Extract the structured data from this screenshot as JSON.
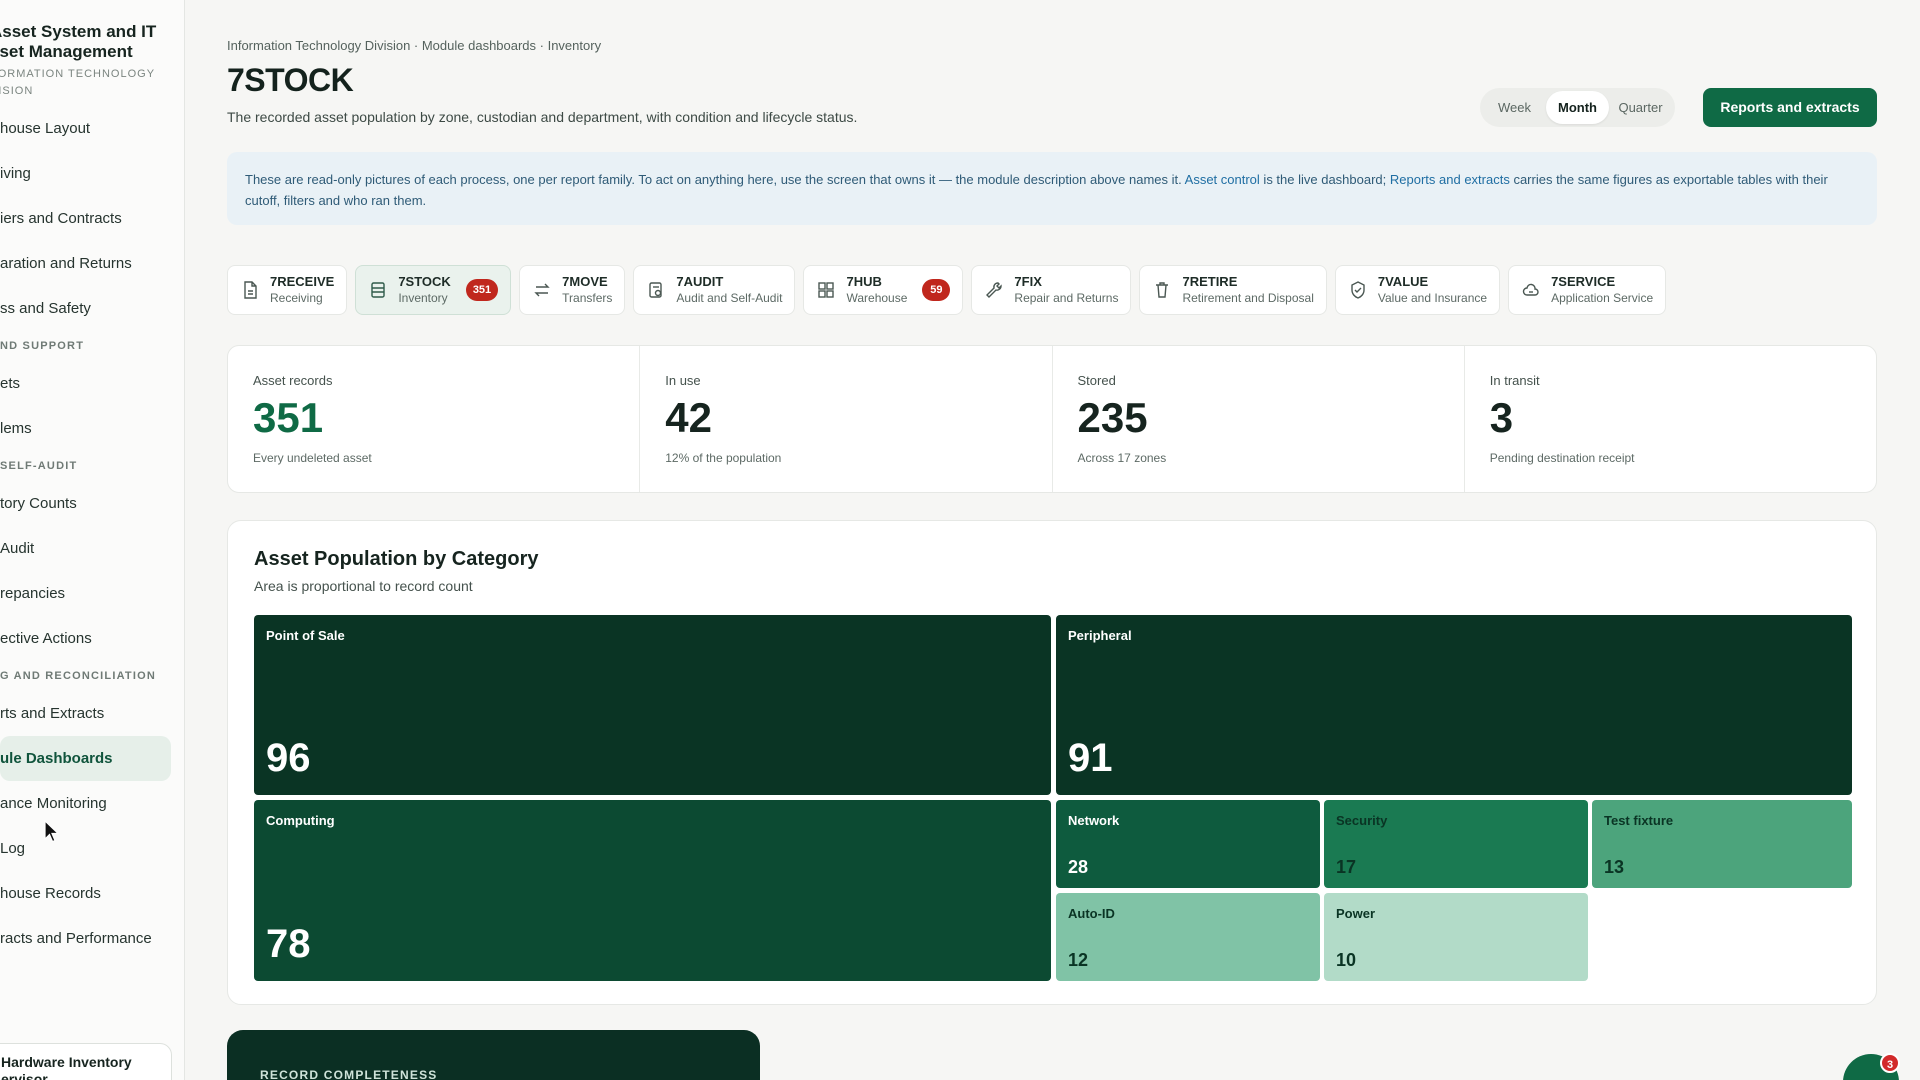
{
  "sidebar": {
    "brand_title_line1": "Asset System and IT",
    "brand_title_line2": "sset Management",
    "brand_sub_line1": "FORMATION TECHNOLOGY",
    "brand_sub_line2": "VISION",
    "items": [
      {
        "type": "item",
        "label": "house Layout"
      },
      {
        "type": "item",
        "label": "iving"
      },
      {
        "type": "item",
        "label": "iers and Contracts"
      },
      {
        "type": "item",
        "label": "aration and Returns"
      },
      {
        "type": "item",
        "label": "ss and Safety"
      },
      {
        "type": "section",
        "label": "ND SUPPORT"
      },
      {
        "type": "item",
        "label": "ets"
      },
      {
        "type": "item",
        "label": "lems"
      },
      {
        "type": "section",
        "label": "SELF-AUDIT"
      },
      {
        "type": "item",
        "label": "tory Counts"
      },
      {
        "type": "item",
        "label": "Audit"
      },
      {
        "type": "item",
        "label": "repancies"
      },
      {
        "type": "item",
        "label": "ective Actions"
      },
      {
        "type": "section",
        "label": "G AND RECONCILIATION"
      },
      {
        "type": "item",
        "label": "rts and Extracts"
      },
      {
        "type": "item",
        "label": "ule Dashboards",
        "active": true
      },
      {
        "type": "item",
        "label": "ance Monitoring"
      },
      {
        "type": "item",
        "label": " Log"
      },
      {
        "type": "item",
        "label": "house Records"
      },
      {
        "type": "item",
        "label": "racts and Performance"
      }
    ],
    "footer_line1": "Hardware Inventory",
    "footer_line2": "ervisor"
  },
  "header": {
    "breadcrumb": "Information Technology Division · Module dashboards · Inventory",
    "title": "7STOCK",
    "description": "The recorded asset population by zone, custodian and department, with condition and lifecycle status.",
    "periods": [
      "Week",
      "Month",
      "Quarter"
    ],
    "selected_period": "Month",
    "reports_button": "Reports and extracts"
  },
  "notice": {
    "text_1": "These are read-only pictures of each process, one per report family. To act on anything here, use the screen that owns it — the module description above names it. ",
    "link_1": "Asset control",
    "text_2": " is the live dashboard; ",
    "link_2": "Reports and extracts",
    "text_3": " carries the same figures as exportable tables with their cutoff, filters and who ran them."
  },
  "tabs": [
    {
      "code": "7RECEIVE",
      "name": "Receiving",
      "icon": "document-icon"
    },
    {
      "code": "7STOCK",
      "name": "Inventory",
      "icon": "list-icon",
      "badge": "351",
      "active": true
    },
    {
      "code": "7MOVE",
      "name": "Transfers",
      "icon": "transfer-icon"
    },
    {
      "code": "7AUDIT",
      "name": "Audit and Self-Audit",
      "icon": "audit-icon"
    },
    {
      "code": "7HUB",
      "name": "Warehouse",
      "icon": "grid-icon",
      "badge": "59"
    },
    {
      "code": "7FIX",
      "name": "Repair and Returns",
      "icon": "wrench-icon"
    },
    {
      "code": "7RETIRE",
      "name": "Retirement and Disposal",
      "icon": "trash-icon"
    },
    {
      "code": "7VALUE",
      "name": "Value and Insurance",
      "icon": "shield-icon"
    },
    {
      "code": "7SERVICE",
      "name": "Application Service",
      "icon": "cloud-icon"
    }
  ],
  "stats": [
    {
      "label": "Asset records",
      "value": "351",
      "note": "Every undeleted asset",
      "accent": true
    },
    {
      "label": "In use",
      "value": "42",
      "note": "12% of the population"
    },
    {
      "label": "Stored",
      "value": "235",
      "note": "Across 17 zones"
    },
    {
      "label": "In transit",
      "value": "3",
      "note": "Pending destination receipt"
    }
  ],
  "chart_data": {
    "type": "treemap",
    "title": "Asset Population by Category",
    "subtitle": "Area is proportional to record count",
    "categories": [
      "Point of Sale",
      "Peripheral",
      "Computing",
      "Network",
      "Security",
      "Test fixture",
      "Auto-ID",
      "Power"
    ],
    "values": [
      96,
      91,
      78,
      28,
      17,
      13,
      12,
      10
    ],
    "colors": [
      "#0a3424",
      "#0a3424",
      "#0c4a32",
      "#0e5b3e",
      "#1a7a52",
      "#4ca47c",
      "#80c3a6",
      "#b2dbc8"
    ]
  },
  "completeness_card": {
    "label": "RECORD COMPLETENESS"
  },
  "chat": {
    "badge": "3"
  }
}
